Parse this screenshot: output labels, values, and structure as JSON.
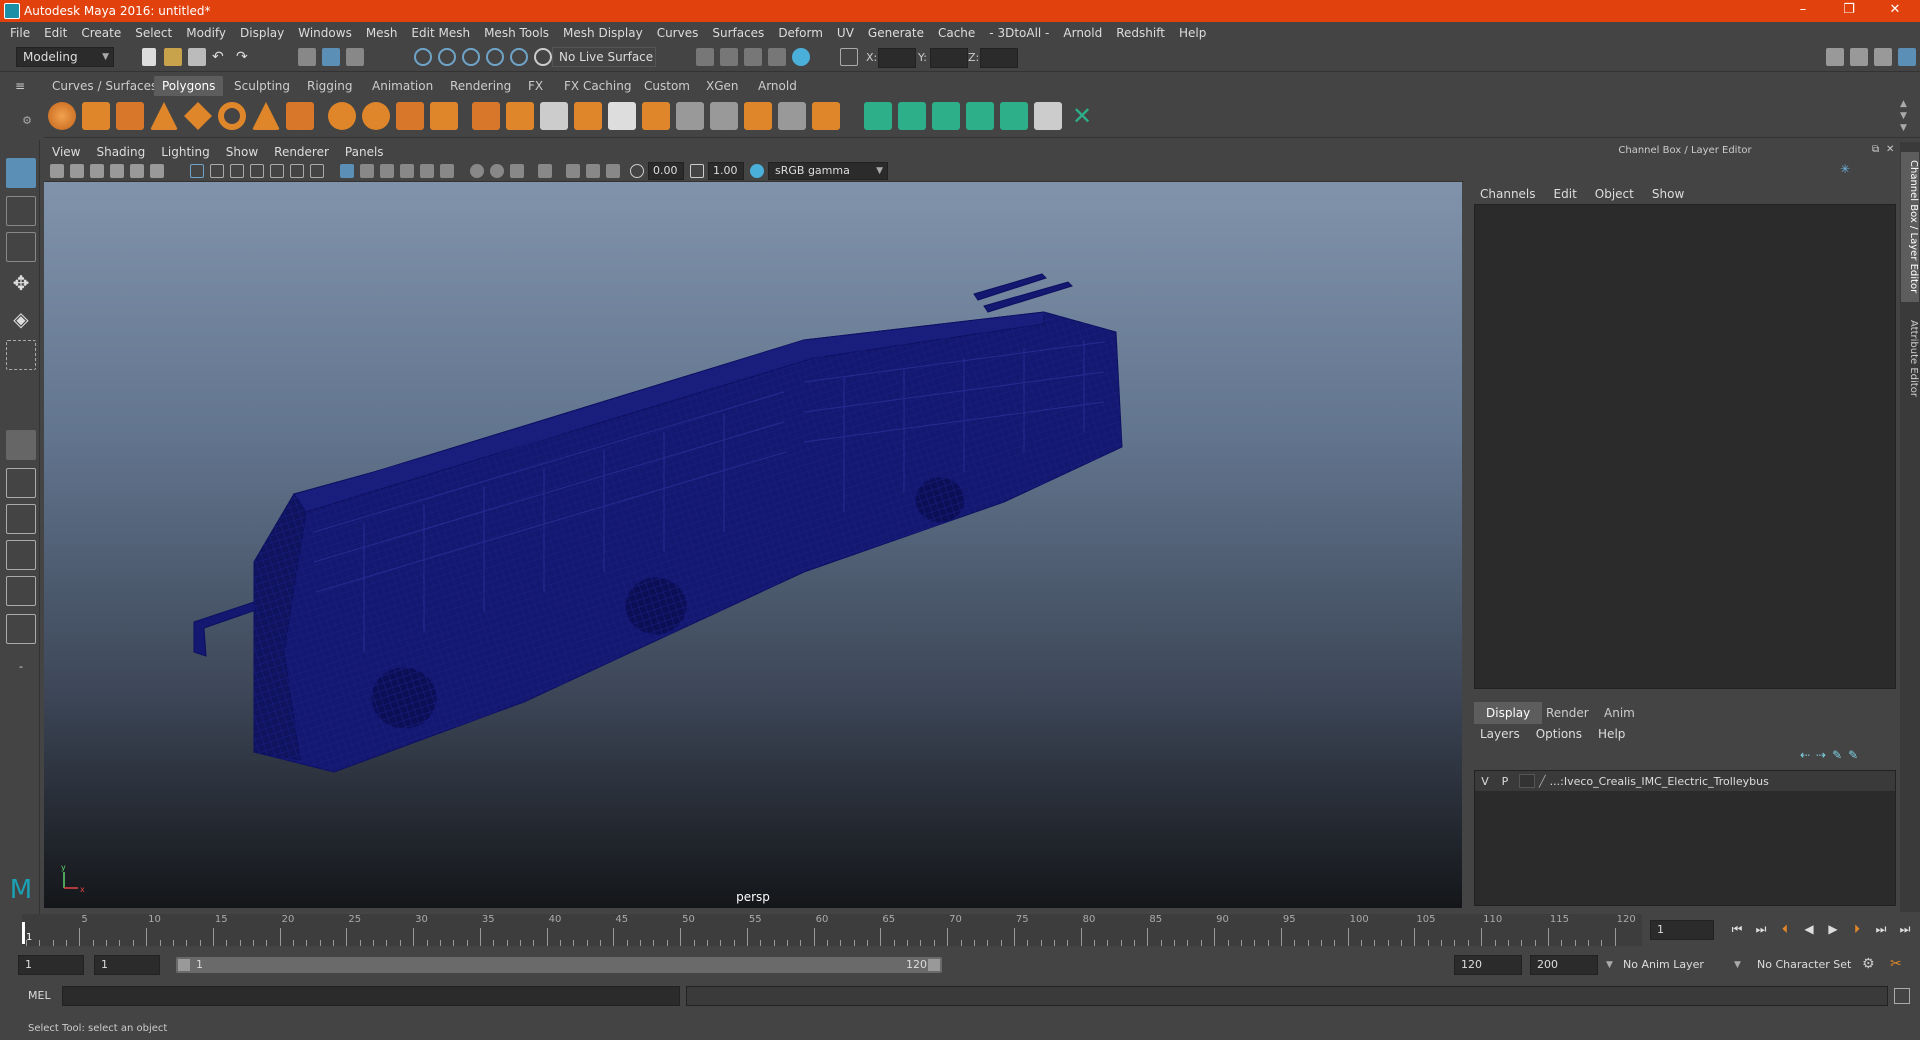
{
  "window": {
    "title": "Autodesk Maya 2016: untitled*",
    "minimize_glyph": "–",
    "restore_glyph": "❐",
    "close_glyph": "✕"
  },
  "menus": [
    "File",
    "Edit",
    "Create",
    "Select",
    "Modify",
    "Display",
    "Windows",
    "Mesh",
    "Edit Mesh",
    "Mesh Tools",
    "Mesh Display",
    "Curves",
    "Surfaces",
    "Deform",
    "UV",
    "Generate",
    "Cache",
    "- 3DtoAll -",
    "Arnold",
    "Redshift",
    "Help"
  ],
  "status_line": {
    "menu_set": "Modeling",
    "live_surface": "No Live Surface",
    "coord_x_label": "X:",
    "coord_y_label": "Y:",
    "coord_z_label": "Z:"
  },
  "shelf_tabs": [
    "Curves / Surfaces",
    "Polygons",
    "Sculpting",
    "Rigging",
    "Animation",
    "Rendering",
    "FX",
    "FX Caching",
    "Custom",
    "XGen",
    "Arnold"
  ],
  "shelf_active": "Polygons",
  "viewport": {
    "menus": [
      "View",
      "Shading",
      "Lighting",
      "Show",
      "Renderer",
      "Panels"
    ],
    "exposure": "0.00",
    "gamma": "1.00",
    "color_space": "sRGB gamma",
    "camera_label": "persp",
    "axis_x": "x",
    "axis_y": "y"
  },
  "channel_box": {
    "title": "Channel Box / Layer Editor",
    "menus": [
      "Channels",
      "Edit",
      "Object",
      "Show"
    ]
  },
  "layer_editor": {
    "tabs": [
      "Display",
      "Render",
      "Anim"
    ],
    "active_tab": "Display",
    "menus": [
      "Layers",
      "Options",
      "Help"
    ],
    "layer": {
      "visible": "V",
      "playback": "P",
      "name": "...:Iveco_Crealis_IMC_Electric_Trolleybus"
    }
  },
  "side_tabs": [
    "Channel Box / Layer Editor",
    "Attribute Editor"
  ],
  "time_slider": {
    "labels": [
      "5",
      "10",
      "15",
      "20",
      "25",
      "30",
      "35",
      "40",
      "45",
      "50",
      "55",
      "60",
      "65",
      "70",
      "75",
      "80",
      "85",
      "90",
      "95",
      "100",
      "105",
      "110",
      "115",
      "120"
    ],
    "start_label": "1",
    "current_frame": "1"
  },
  "range_slider": {
    "start": "1",
    "playback_start": "1",
    "bar_start": "1",
    "bar_end": "120",
    "playback_end": "120",
    "end": "200",
    "anim_layer": "No Anim Layer",
    "character_set": "No Character Set"
  },
  "command_line": {
    "label": "MEL"
  },
  "help_line": {
    "text": "Select Tool: select an object"
  },
  "colors": {
    "title_bar": "#e1420d",
    "ui_bg": "#444444",
    "wireframe": "#141870",
    "shelf_orange": "#e0862a",
    "shelf_teal": "#2db08a"
  }
}
